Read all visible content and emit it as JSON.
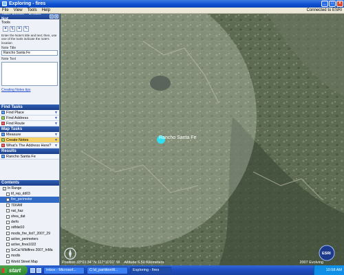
{
  "window": {
    "title": "Exploring - fires",
    "icon": "globe-icon"
  },
  "menubar": {
    "items": [
      "File",
      "View",
      "Tools",
      "Help"
    ],
    "connection_status": "Connected to ESRI"
  },
  "task_center": {
    "header": "Task Center - Create Not...",
    "tools_label": "Tools",
    "instructions": "Enter the Note's title and text; then, use one of the tools indicate the note's location",
    "note_title_label": "Note Title",
    "note_title_value": "Rancho Santa Fe",
    "note_text_label": "Note Text",
    "note_text_value": "",
    "tips_link": "Creating Notes tips"
  },
  "find_tasks": {
    "header": "Find Tasks",
    "items": [
      {
        "label": "Find Place",
        "icon": "find-place-icon"
      },
      {
        "label": "Find Address",
        "icon": "find-address-icon"
      },
      {
        "label": "Find Route",
        "icon": "find-route-icon"
      }
    ]
  },
  "map_tasks": {
    "header": "Map Tasks",
    "items": [
      {
        "label": "Measure",
        "icon": "measure-icon"
      },
      {
        "label": "Create Notes",
        "icon": "create-notes-icon"
      },
      {
        "label": "What's The Address Here?",
        "icon": "address-icon"
      }
    ]
  },
  "results": {
    "header": "Results",
    "items": [
      {
        "label": "Rancho Santa Fe"
      }
    ]
  },
  "contents": {
    "header": "Contents",
    "items": [
      {
        "label": "In Range",
        "checked": true
      },
      {
        "label": "tif_rep_dd03",
        "checked": false
      },
      {
        "label": "fire_perimeter",
        "checked": true
      },
      {
        "label": "70XAM",
        "checked": false
      },
      {
        "label": "nat_haz",
        "checked": false
      },
      {
        "label": "shea_dat",
        "checked": false
      },
      {
        "label": "dvrfo",
        "checked": false
      },
      {
        "label": "odfdat10",
        "checked": false
      },
      {
        "label": "modis_fire_list7_2007_29",
        "checked": false
      },
      {
        "label": "active_perimeters",
        "checked": false
      },
      {
        "label": "active_fires1022",
        "checked": false
      },
      {
        "label": "SoCal Wildfires 2007_InMa",
        "checked": false
      },
      {
        "label": "modis",
        "checked": false
      },
      {
        "label": "World Street Map",
        "checked": false
      }
    ]
  },
  "map": {
    "place_label": "Rancho Santa Fe",
    "marker_color": "#2fe0f0",
    "watermark": "ESRI"
  },
  "statusbar": {
    "position": "Position  33°01'34\" N  117°11'01\" W",
    "altitude": "Altitude  6.50 Kilometers",
    "copyright": "2007 Evolving"
  },
  "taskbar": {
    "start_label": "start",
    "tasks": [
      {
        "label": "Inbox - Microsof...",
        "active": false
      },
      {
        "label": "C:\\d_partition\\fi...",
        "active": false
      },
      {
        "label": "Exploring - fires",
        "active": true
      }
    ],
    "clock": "10:58 AM"
  }
}
